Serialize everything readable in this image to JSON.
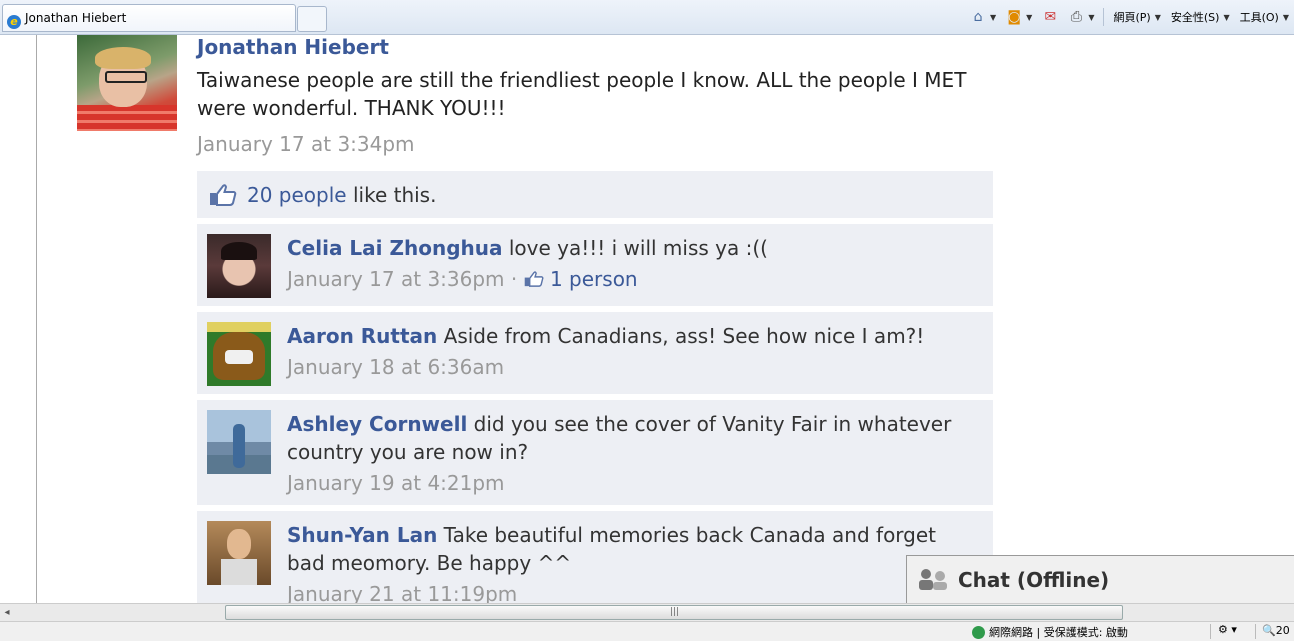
{
  "browser": {
    "tab_title": "Jonathan Hiebert",
    "toolbar": {
      "page_menu": "網頁(P)",
      "safety_menu": "安全性(S)",
      "tools_menu": "工具(O)"
    }
  },
  "post": {
    "author": "Jonathan Hiebert",
    "message": "Taiwanese people are still the friendliest people I know. ALL the people I MET were wonderful. THANK YOU!!!",
    "timestamp": "January 17 at 3:34pm",
    "likes": {
      "count_link": "20 people",
      "suffix": " like this."
    }
  },
  "comments": [
    {
      "name": "Celia Lai Zhonghua",
      "text": " love ya!!! i will miss ya :((",
      "time": "January 17 at 3:36pm",
      "separator": " · ",
      "like_link": "1 person"
    },
    {
      "name": "Aaron Ruttan",
      "text": " Aside from Canadians, ass! See how nice I am?!",
      "time": "January 18 at 6:36am"
    },
    {
      "name": "Ashley Cornwell",
      "text": " did you see the cover of Vanity Fair in whatever country you are now in?",
      "time": "January 19 at 4:21pm"
    },
    {
      "name": "Shun-Yan Lan",
      "text": " Take beautiful memories back Canada and forget bad meomory. Be happy ^^",
      "time": "January 21 at 11:19pm"
    }
  ],
  "chat": {
    "label": "Chat (Offline)"
  },
  "statusbar": {
    "zone_text": "網際網路 | 受保護模式: 啟動",
    "zoom": "20"
  }
}
